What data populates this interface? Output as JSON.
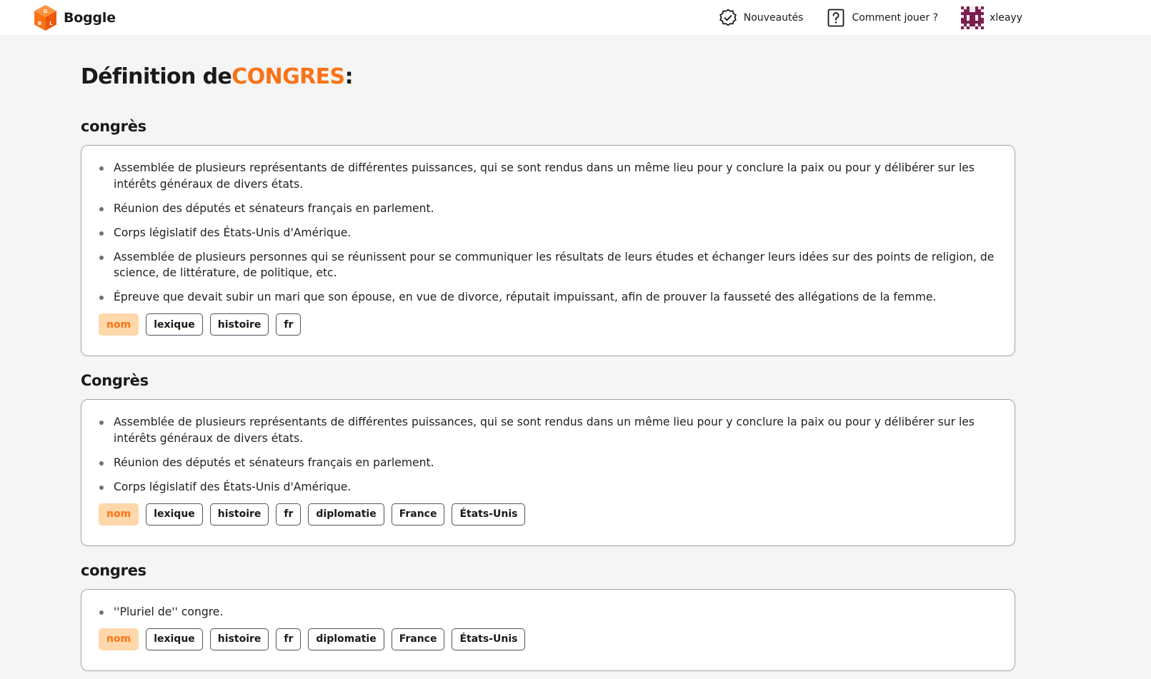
{
  "header": {
    "brand": "Boggle",
    "nav": [
      {
        "label": "Nouveautés",
        "icon": "badge-check-icon"
      },
      {
        "label": "Comment jouer ?",
        "icon": "question-square-icon"
      }
    ],
    "user": {
      "name": "xleayy",
      "avatar_icon": "pixel-avatar-icon"
    }
  },
  "page": {
    "title_prefix": "Définition de",
    "word": "CONGRES",
    "title_suffix": ":"
  },
  "entries": [
    {
      "title": "congrès",
      "definitions": [
        "Assemblée de plusieurs représentants de différentes puissances, qui se sont rendus dans un même lieu pour y conclure la paix ou pour y délibérer sur les intérêts généraux de divers états.",
        "Réunion des députés et sénateurs français en parlement.",
        "Corps législatif des États-Unis d'Amérique.",
        "Assemblée de plusieurs personnes qui se réunissent pour se communiquer les résultats de leurs études et échanger leurs idées sur des points de religion, de science, de littérature, de politique, etc.",
        "Épreuve que devait subir un mari que son épouse, en vue de divorce, réputait impuissant, afin de prouver la fausseté des allégations de la femme."
      ],
      "pos": "nom",
      "tags": [
        "lexique",
        "histoire",
        "fr"
      ]
    },
    {
      "title": "Congrès",
      "definitions": [
        "Assemblée de plusieurs représentants de différentes puissances, qui se sont rendus dans un même lieu pour y conclure la paix ou pour y délibérer sur les intérêts généraux de divers états.",
        "Réunion des députés et sénateurs français en parlement.",
        "Corps législatif des États-Unis d'Amérique."
      ],
      "pos": "nom",
      "tags": [
        "lexique",
        "histoire",
        "fr",
        "diplomatie",
        "France",
        "États-Unis"
      ]
    },
    {
      "title": "congres",
      "definitions": [
        "''Pluriel de'' congre."
      ],
      "pos": "nom",
      "tags": [
        "lexique",
        "histoire",
        "fr",
        "diplomatie",
        "France",
        "États-Unis"
      ]
    }
  ],
  "colors": {
    "accent": "#f97316",
    "pos_tag_bg": "#fed7aa",
    "page_bg": "#f5f5f5"
  }
}
